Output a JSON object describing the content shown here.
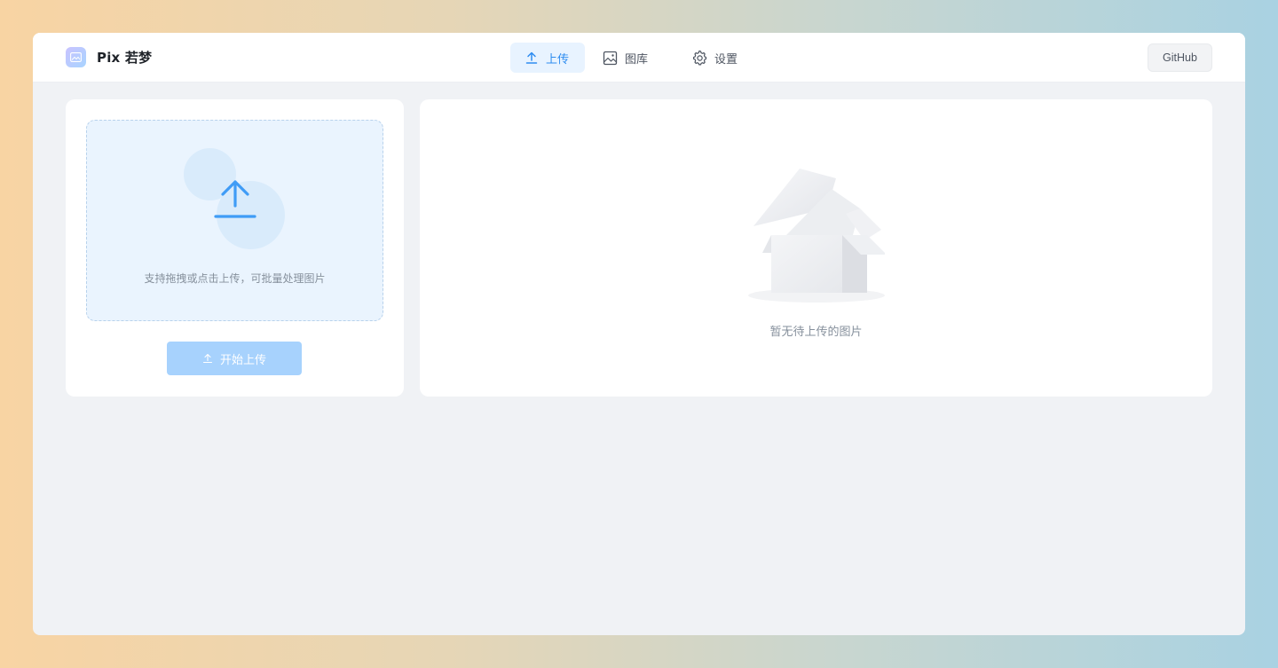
{
  "app": {
    "name": "Pix 若梦"
  },
  "nav": {
    "upload": "上传",
    "gallery": "图库",
    "settings": "设置"
  },
  "header": {
    "github": "GitHub"
  },
  "upload_panel": {
    "hint": "支持拖拽或点击上传，可批量处理图片",
    "start_button": "开始上传"
  },
  "result_panel": {
    "empty_text": "暂无待上传的图片"
  },
  "colors": {
    "accent": "#2e8cf0",
    "active_nav_bg": "#e8f3ff",
    "button_disabled": "#a7d2fd"
  },
  "icons": [
    "logo-icon",
    "upload-icon",
    "image-icon",
    "gear-icon",
    "upload-arrow-icon",
    "empty-box-icon"
  ]
}
